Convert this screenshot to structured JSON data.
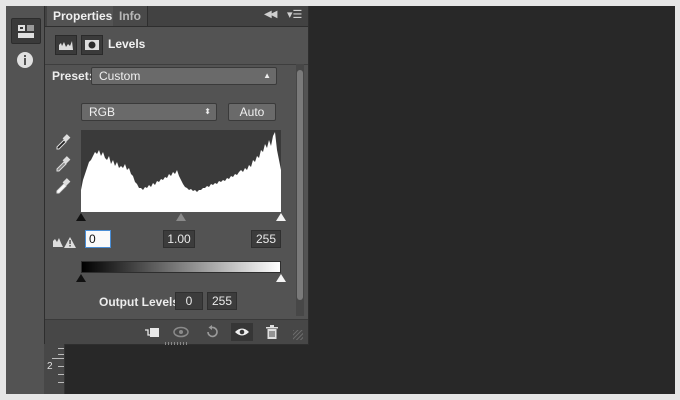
{
  "tabs": [
    {
      "label": "Properties",
      "active": true
    },
    {
      "label": "Info",
      "active": false
    }
  ],
  "header": {
    "title": "Levels",
    "icons": [
      "histogram-levels-icon",
      "layer-mask-icon"
    ]
  },
  "preset": {
    "label": "Preset:",
    "value": "Custom"
  },
  "channel": {
    "value": "RGB"
  },
  "auto_label": "Auto",
  "input_levels": {
    "black": "0",
    "gamma": "1.00",
    "white": "255"
  },
  "output_levels": {
    "label": "Output Levels:",
    "black": "0",
    "white": "255"
  },
  "ruler": {
    "mark": "2"
  },
  "tools": [
    "adjustments-icon",
    "info-icon"
  ],
  "footer_icons": [
    "clip-to-layer-icon",
    "view-previous-state-icon",
    "reset-icon",
    "toggle-visibility-icon",
    "delete-icon"
  ],
  "colors": {
    "panel": "#535353",
    "canvas": "#282828",
    "focus": "#4a8ed6"
  }
}
